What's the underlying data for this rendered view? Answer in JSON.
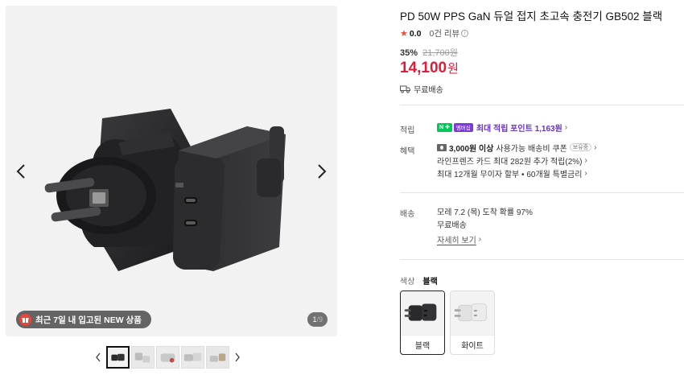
{
  "product": {
    "title": "PD 50W PPS GaN 듀얼 접지 초고속 충전기 GB502 블랙",
    "rating": "0.0",
    "review_count": "0건 리뷰",
    "review_help_icon": "i",
    "discount_pct": "35%",
    "original_price": "21,700원",
    "price": "14,100",
    "price_unit": "원",
    "shipping_badge": "무료배송"
  },
  "gallery": {
    "new_badge": "최근 7일 내 입고된 NEW 상품",
    "counter_current": "1",
    "counter_total": "/9",
    "thumbnail_count": 5
  },
  "points": {
    "label": "적립",
    "npay_badge": "N ✚",
    "membership_badge": "멤버십",
    "text": "최대 적립 포인트 1,163원"
  },
  "benefits": {
    "label": "혜택",
    "coupon_strong": "3,000원 이상",
    "coupon_text": "사용가능 배송비 쿠폰",
    "coupon_tag": "보유중",
    "card_text": "라인프렌즈 카드 최대 282원 추가 적립(2%)",
    "installment_text": "최대 12개월 무이자 할부 • 60개월 특별금리"
  },
  "delivery": {
    "label": "배송",
    "eta": "모레 7.2 (목) 도착 확률 97%",
    "fee": "무료배송",
    "more": "자세히 보기"
  },
  "color": {
    "label": "색상",
    "selected": "블랙",
    "options": [
      "블랙",
      "화이트"
    ]
  },
  "colors": {
    "price_red": "#e51937",
    "point_purple": "#6a2ed8",
    "star_red": "#f04a3a",
    "npay_green": "#03c75a"
  },
  "icons": {
    "prev": "chevron-left-icon",
    "next": "chevron-right-icon",
    "gift": "gift-icon",
    "truck": "truck-icon",
    "star": "star-icon",
    "coupon": "coupon-icon"
  }
}
